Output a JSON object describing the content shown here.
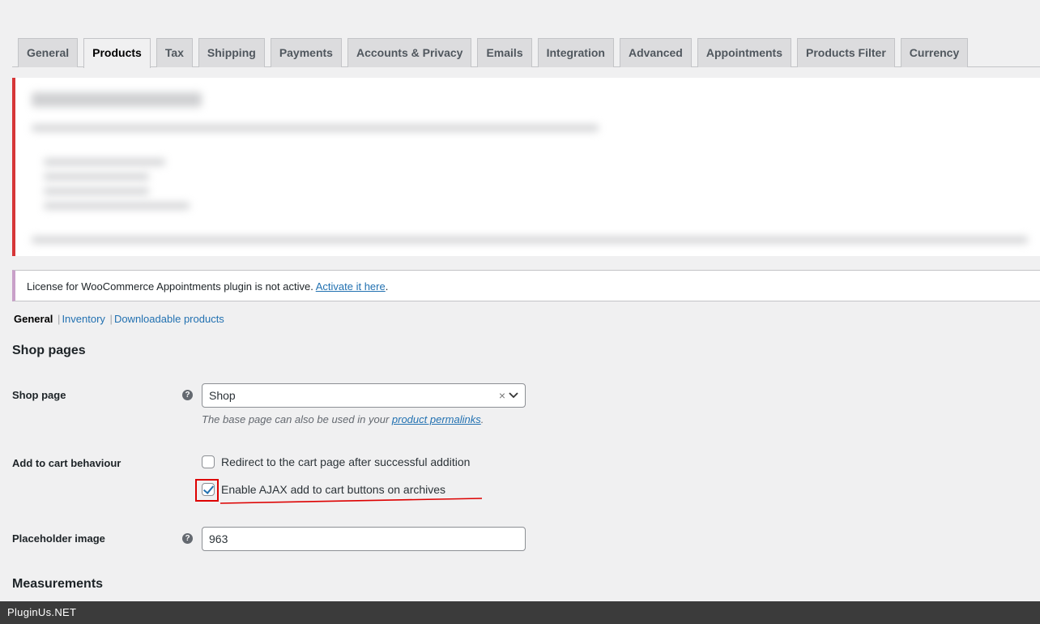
{
  "tabs": [
    "General",
    "Products",
    "Tax",
    "Shipping",
    "Payments",
    "Accounts & Privacy",
    "Emails",
    "Integration",
    "Advanced",
    "Appointments",
    "Products Filter",
    "Currency"
  ],
  "notice": {
    "text": "License for WooCommerce Appointments plugin is not active. ",
    "link": "Activate it here",
    "end": "."
  },
  "subnav": {
    "current": "General",
    "inventory": "Inventory",
    "downloadable": "Downloadable products",
    "sep": "|"
  },
  "shop_pages": {
    "heading": "Shop pages",
    "shop_page_label": "Shop page",
    "shop_page_value": "Shop",
    "clear": "×",
    "chevron": "⌄",
    "desc_prefix": "The base page can also be used in your ",
    "desc_link": "product permalinks",
    "desc_end": ".",
    "cart_label": "Add to cart behaviour",
    "redirect_label": "Redirect to the cart page after successful addition",
    "ajax_label": "Enable AJAX add to cart buttons on archives",
    "placeholder_label": "Placeholder image",
    "placeholder_value": "963",
    "help": "?"
  },
  "measurements": {
    "heading": "Measurements"
  },
  "footer": {
    "brand": "PluginUs.NET"
  }
}
